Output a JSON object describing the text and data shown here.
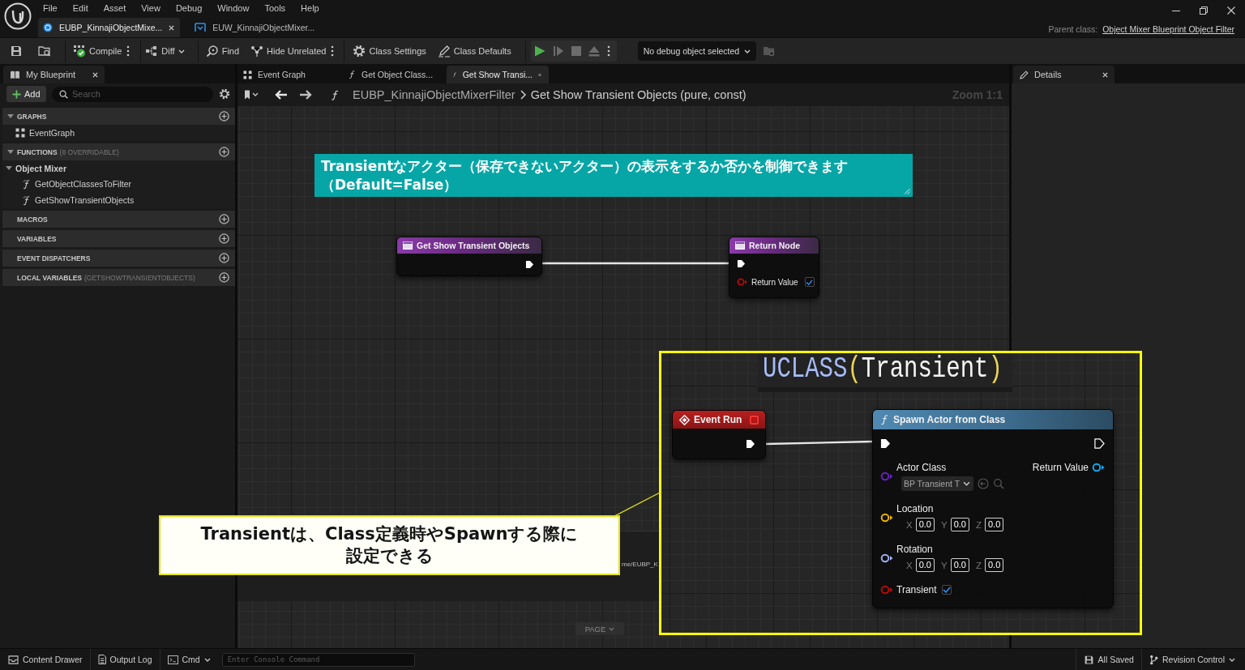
{
  "title_bar": {
    "menu": [
      "File",
      "Edit",
      "Asset",
      "View",
      "Debug",
      "Window",
      "Tools",
      "Help"
    ],
    "document_tabs": [
      {
        "label": "EUBP_KinnajiObjectMixe...",
        "kind": "blueprint",
        "selected": true
      },
      {
        "label": "EUW_KinnajiObjectMixer...",
        "kind": "widget",
        "selected": false
      }
    ],
    "parent_class_label": "Parent class:",
    "parent_class": "Object Mixer Blueprint Object Filter"
  },
  "toolbar": {
    "compile": "Compile",
    "diff": "Diff",
    "find": "Find",
    "hide_unrelated": "Hide Unrelated",
    "class_settings": "Class Settings",
    "class_defaults": "Class Defaults",
    "debug_object": "No debug object selected"
  },
  "my_blueprint": {
    "tab": "My Blueprint",
    "add_button": "Add",
    "search": {
      "placeholder": "Search"
    },
    "sections": [
      {
        "title": "GRAPHS",
        "expanded": true,
        "items": [
          {
            "label": "EventGraph",
            "kind": "graph"
          }
        ]
      },
      {
        "title": "FUNCTIONS",
        "note": "(8 OVERRIDABLE)",
        "expanded": true,
        "items": [
          {
            "label": "Object Mixer",
            "kind": "category",
            "expanded": true,
            "children": [
              {
                "label": "GetObjectClassesToFilter",
                "kind": "function"
              },
              {
                "label": "GetShowTransientObjects",
                "kind": "function"
              }
            ]
          }
        ]
      },
      {
        "title": "MACROS",
        "expanded": false
      },
      {
        "title": "VARIABLES",
        "expanded": false
      },
      {
        "title": "EVENT DISPATCHERS",
        "expanded": false
      },
      {
        "title": "LOCAL VARIABLES",
        "note": "(GETSHOWTRANSIENTOBJECTS)",
        "expanded": false
      }
    ]
  },
  "graph_editor": {
    "tabs": [
      {
        "label": "Event Graph",
        "kind": "graph",
        "selected": false
      },
      {
        "label": "Get Object Class...",
        "kind": "function",
        "selected": false
      },
      {
        "label": "Get Show Transi...",
        "kind": "function",
        "selected": true
      }
    ],
    "breadcrumb": {
      "blueprint": "EUBP_KinnajiObjectMixerFilter",
      "function": "Get Show Transient Objects (pure, const)"
    },
    "zoom": "Zoom 1:1",
    "comment": "Transientなアクター（保存できないアクター）の表示をするか否かを制御できます（Default=False）",
    "nodes": [
      {
        "kind": "entry",
        "title": "Get Show Transient Objects"
      },
      {
        "kind": "result",
        "title": "Return Node",
        "pins": [
          {
            "label": "Return Value",
            "kind": "bool",
            "checked": true
          }
        ]
      }
    ],
    "path_fragment": "me/EUBP_K",
    "page_button": "PAGE"
  },
  "details_panel": {
    "tab": "Details"
  },
  "inset": {
    "code": [
      {
        "text": "UCLASS",
        "kind": "macro"
      },
      {
        "text": "(",
        "kind": "punct"
      },
      {
        "text": "Transient",
        "kind": "name"
      },
      {
        "text": ")",
        "kind": "punct"
      }
    ],
    "nodes": [
      {
        "kind": "event",
        "title": "Event Run"
      },
      {
        "kind": "function",
        "title": "Spawn Actor from Class",
        "output": {
          "label": "Return Value",
          "kind": "object"
        },
        "pins": [
          {
            "label": "Actor Class",
            "kind": "class",
            "value": "BP Transient T"
          },
          {
            "label": "Location",
            "kind": "vector",
            "components": [
              {
                "axis": "X",
                "value": "0.0"
              },
              {
                "axis": "Y",
                "value": "0.0"
              },
              {
                "axis": "Z",
                "value": "0.0"
              }
            ]
          },
          {
            "label": "Rotation",
            "kind": "rotator",
            "components": [
              {
                "axis": "X",
                "value": "0.0"
              },
              {
                "axis": "Y",
                "value": "0.0"
              },
              {
                "axis": "Z",
                "value": "0.0"
              }
            ]
          },
          {
            "label": "Transient",
            "kind": "bool",
            "checked": true
          }
        ]
      }
    ]
  },
  "callout": "Transientは、Class定義時やSpawnする際に設定できる",
  "status_bar": {
    "content_drawer": "Content Drawer",
    "output_log": "Output Log",
    "cmd": "Cmd",
    "console": {
      "placeholder": "Enter Console Command"
    },
    "save_state": "All Saved",
    "revision_control": "Revision Control"
  }
}
